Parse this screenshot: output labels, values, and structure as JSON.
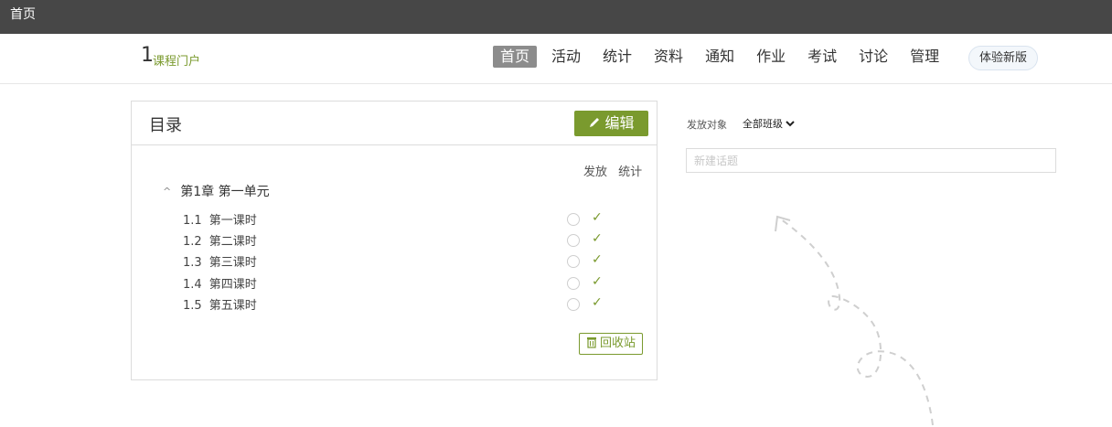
{
  "topbar": {
    "title": "首页"
  },
  "course": {
    "number": "1",
    "name": "课程门户"
  },
  "nav": {
    "items": [
      {
        "label": "首页",
        "active": true
      },
      {
        "label": "活动"
      },
      {
        "label": "统计"
      },
      {
        "label": "资料"
      },
      {
        "label": "通知"
      },
      {
        "label": "作业"
      },
      {
        "label": "考试"
      },
      {
        "label": "讨论"
      },
      {
        "label": "管理"
      }
    ],
    "try_new_label": "体验新版"
  },
  "catalog": {
    "title": "目录",
    "edit_label": "编辑",
    "col_release": "发放",
    "col_stats": "统计",
    "chapter": {
      "caret": "^",
      "label": "第1章 第一单元"
    },
    "lessons": [
      {
        "num": "1.1",
        "title": "第一课时"
      },
      {
        "num": "1.2",
        "title": "第二课时"
      },
      {
        "num": "1.3",
        "title": "第三课时"
      },
      {
        "num": "1.4",
        "title": "第四课时"
      },
      {
        "num": "1.5",
        "title": "第五课时"
      }
    ],
    "check_glyph": "✓",
    "recycle_label": "回收站"
  },
  "side": {
    "release_label": "发放对象",
    "release_value": "全部班级",
    "topic_placeholder": "新建话题"
  },
  "colors": {
    "accent": "#7a9a2e",
    "topbar": "#474747",
    "nav_active": "#8c8c8c"
  }
}
